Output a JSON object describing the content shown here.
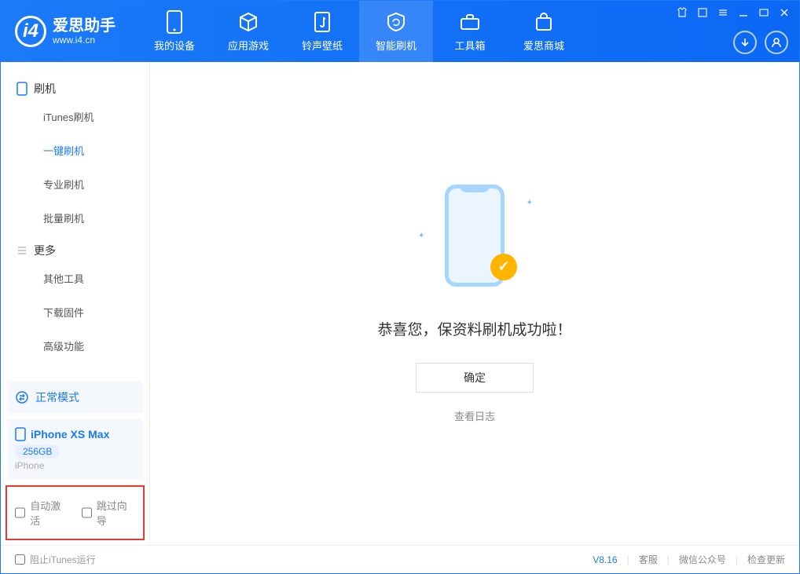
{
  "app": {
    "name_cn": "爱思助手",
    "name_en": "www.i4.cn"
  },
  "nav": {
    "items": [
      {
        "label": "我的设备"
      },
      {
        "label": "应用游戏"
      },
      {
        "label": "铃声壁纸"
      },
      {
        "label": "智能刷机"
      },
      {
        "label": "工具箱"
      },
      {
        "label": "爱思商城"
      }
    ]
  },
  "sidebar": {
    "group1": "刷机",
    "items1": [
      {
        "label": "iTunes刷机"
      },
      {
        "label": "一键刷机"
      },
      {
        "label": "专业刷机"
      },
      {
        "label": "批量刷机"
      }
    ],
    "group2": "更多",
    "items2": [
      {
        "label": "其他工具"
      },
      {
        "label": "下载固件"
      },
      {
        "label": "高级功能"
      }
    ],
    "mode": "正常模式",
    "device": {
      "name": "iPhone XS Max",
      "capacity": "256GB",
      "type": "iPhone"
    },
    "chk1": "自动激活",
    "chk2": "跳过向导"
  },
  "main": {
    "success": "恭喜您，保资料刷机成功啦！",
    "ok": "确定",
    "log": "查看日志"
  },
  "footer": {
    "block_itunes": "阻止iTunes运行",
    "version": "V8.16",
    "links": [
      "客服",
      "微信公众号",
      "检查更新"
    ]
  }
}
